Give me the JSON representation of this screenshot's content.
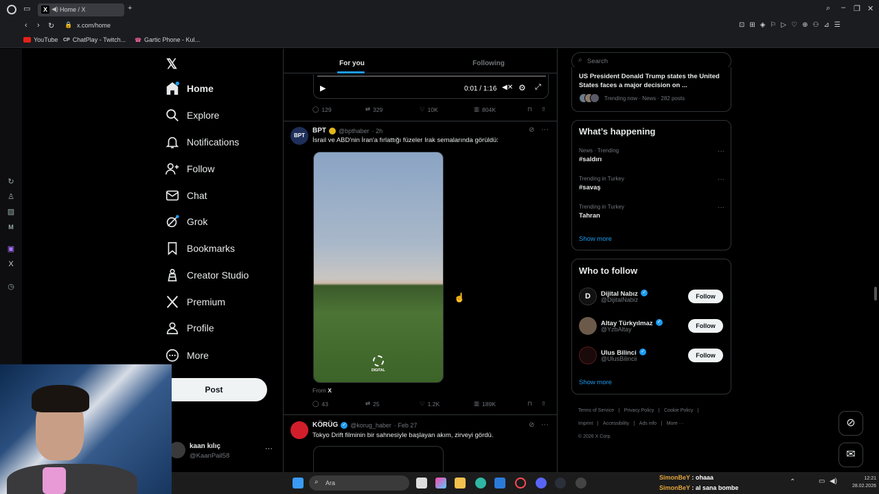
{
  "browser": {
    "tab_title": "Home / X",
    "url": "x.com/home",
    "bookmarks": [
      "YouTube",
      "ChatPlay - Twitch...",
      "Gartic Phone - Kul..."
    ]
  },
  "nav": {
    "items": [
      {
        "label": "Home",
        "icon": "home-icon"
      },
      {
        "label": "Explore",
        "icon": "search-icon"
      },
      {
        "label": "Notifications",
        "icon": "bell-icon"
      },
      {
        "label": "Follow",
        "icon": "person-plus-icon"
      },
      {
        "label": "Chat",
        "icon": "mail-icon"
      },
      {
        "label": "Grok",
        "icon": "grok-icon"
      },
      {
        "label": "Bookmarks",
        "icon": "bookmark-icon"
      },
      {
        "label": "Creator Studio",
        "icon": "creator-icon"
      },
      {
        "label": "Premium",
        "icon": "x-logo-icon"
      },
      {
        "label": "Profile",
        "icon": "person-icon"
      },
      {
        "label": "More",
        "icon": "more-circle-icon"
      }
    ],
    "post_label": "Post",
    "account": {
      "name": "kaan kılıç",
      "handle": "@KaanPail58"
    }
  },
  "feed": {
    "tabs": [
      "For you",
      "Following"
    ],
    "video_time": "0:01 / 1:16",
    "tweet0_actions": {
      "replies": "129",
      "reposts": "329",
      "likes": "10K",
      "views": "804K"
    },
    "tweet1": {
      "author": "BPT",
      "handle": "@bpthaber",
      "time": "· 2h",
      "text": "İsrail ve ABD'nin İran'a fırlattığı füzeler Irak semalarında görüldü:",
      "from_label": "From",
      "from_source": "X",
      "replies": "43",
      "reposts": "25",
      "likes": "1.2K",
      "views": "189K",
      "watermark": "DIGITAL"
    },
    "tweet2": {
      "author": "KÖRÜG",
      "handle": "@korug_haber",
      "time": "· Feb 27",
      "text": "Tokyo Drift filminin bir sahnesiyle başlayan akım, zirveyi gördü."
    }
  },
  "right": {
    "search_placeholder": "Search",
    "top_trend": {
      "headline": "US President Donald Trump states the United States faces a major decision on ...",
      "meta": "Trending now · News · 282 posts"
    },
    "happening_title": "What’s happening",
    "trends": [
      {
        "category": "News · Trending",
        "name": "#saldırı"
      },
      {
        "category": "Trending in Turkey",
        "name": "#savaş"
      },
      {
        "category": "Trending in Turkey",
        "name": "Tahran"
      }
    ],
    "show_more": "Show more",
    "who_title": "Who to follow",
    "who": [
      {
        "name": "Dijital Nabız",
        "handle": "@DijitalNabiz"
      },
      {
        "name": "Altay Türkyılmaz",
        "handle": "@YzbAltay"
      },
      {
        "name": "Ulus Bilinci",
        "handle": "@UlusBilincii"
      }
    ],
    "follow_label": "Follow",
    "footer": [
      "Terms of Service",
      "Privacy Policy",
      "Cookie Policy",
      "Imprint",
      "Accessibility",
      "Ads info",
      "More ···",
      "© 2026 X Corp."
    ]
  },
  "taskbar": {
    "search_placeholder": "Ara",
    "chat": [
      {
        "user": "SimonBeY",
        "msg": ": ohaaa"
      },
      {
        "user": "SimonBeY",
        "msg": ": al sana bombe"
      }
    ],
    "clock_time": "12:21",
    "clock_date": "28.02.2026"
  },
  "colors": {
    "accent": "#1d9bf0",
    "chat_user": "#e0a23c"
  }
}
